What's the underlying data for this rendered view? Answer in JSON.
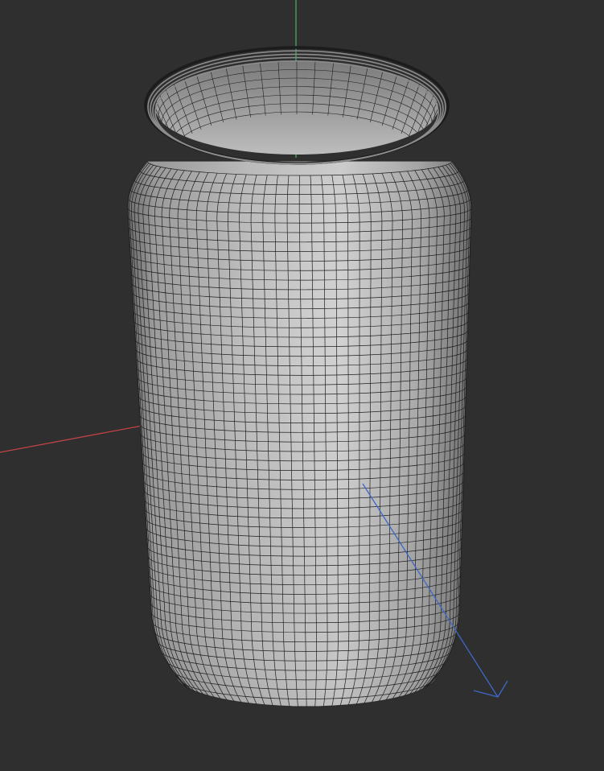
{
  "viewport": {
    "background_color": "#2f2f2f",
    "mesh_object": "can-body",
    "mesh_rows": 58,
    "mesh_columns": 44,
    "rim_rings": 5,
    "wireframe_color": "#1f1f1f",
    "shading": {
      "light": "#cfcfcf",
      "mid": "#a6a6a6",
      "dark": "#5c5c5c"
    },
    "axes": {
      "x": {
        "color": "#c04444"
      },
      "y": {
        "color": "#3fae55"
      },
      "z": {
        "color": "#3f66c9"
      }
    }
  }
}
